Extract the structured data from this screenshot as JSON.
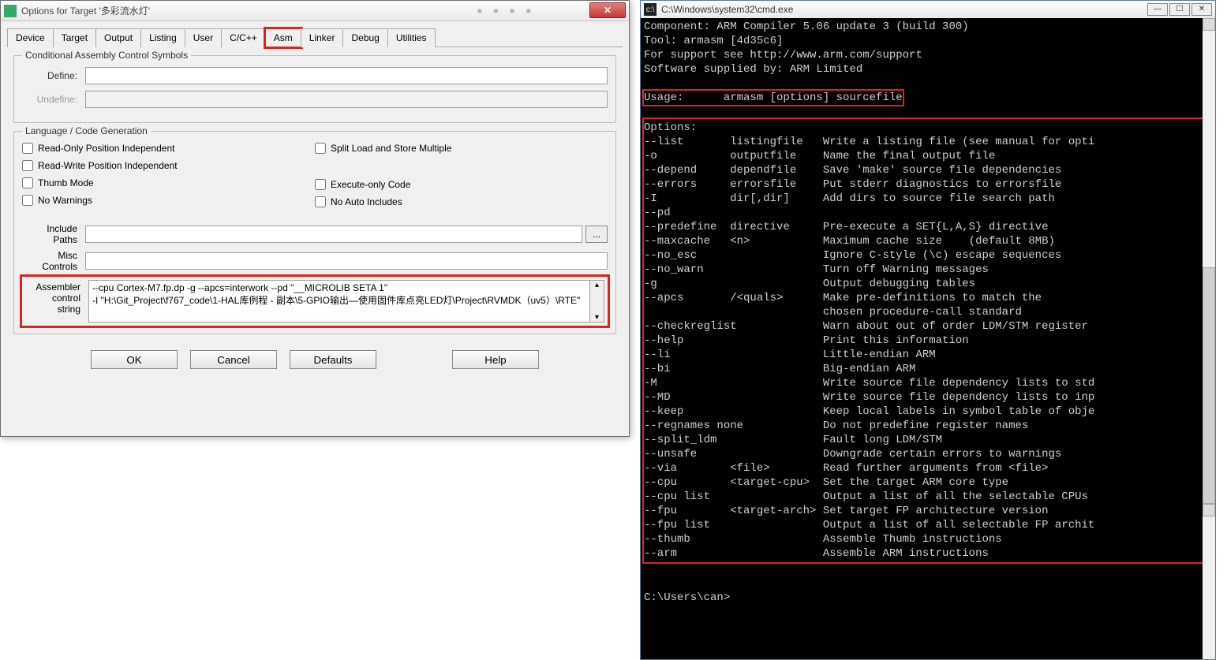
{
  "dialog": {
    "title": "Options for Target '多彩流水灯'",
    "tabs": [
      "Device",
      "Target",
      "Output",
      "Listing",
      "User",
      "C/C++",
      "Asm",
      "Linker",
      "Debug",
      "Utilities"
    ],
    "active_tab": 6,
    "group_conditional": {
      "legend": "Conditional Assembly Control Symbols",
      "define_label": "Define:",
      "undefine_label": "Undefine:",
      "define_value": "",
      "undefine_value": ""
    },
    "group_lang": {
      "legend": "Language / Code Generation",
      "checks_left": [
        "Read-Only Position Independent",
        "Read-Write Position Independent",
        "Thumb Mode",
        "No Warnings"
      ],
      "checks_right": [
        "Split Load and Store Multiple",
        "Execute-only Code",
        "No Auto Includes"
      ]
    },
    "group_paths": {
      "include_label": "Include\nPaths",
      "misc_label": "Misc\nControls",
      "assembler_label": "Assembler\ncontrol\nstring",
      "browse": "...",
      "assembler_value": "--cpu Cortex-M7.fp.dp -g --apcs=interwork --pd \"__MICROLIB SETA 1\"\n-I \"H:\\Git_Project\\f767_code\\1-HAL库例程 - 副本\\5-GPIO输出—使用固件库点亮LED灯\\Project\\RVMDK（uv5）\\RTE\""
    },
    "buttons": {
      "ok": "OK",
      "cancel": "Cancel",
      "defaults": "Defaults",
      "help": "Help"
    }
  },
  "cmd": {
    "title": "C:\\Windows\\system32\\cmd.exe",
    "header": "Component: ARM Compiler 5.06 update 3 (build 300)\nTool: armasm [4d35c6]\nFor support see http://www.arm.com/support\nSoftware supplied by: ARM Limited",
    "usage": "Usage:      armasm [options] sourcefile",
    "options_hdr": "Options:",
    "options_body": "--list       listingfile   Write a listing file (see manual for opti\n-o           outputfile    Name the final output file\n--depend     dependfile    Save 'make' source file dependencies\n--errors     errorsfile    Put stderr diagnostics to errorsfile\n-I           dir[,dir]     Add dirs to source file search path\n--pd\n--predefine  directive     Pre-execute a SET{L,A,S} directive\n--maxcache   <n>           Maximum cache size    (default 8MB)\n--no_esc                   Ignore C-style (\\c) escape sequences\n--no_warn                  Turn off Warning messages\n-g                         Output debugging tables\n--apcs       /<quals>      Make pre-definitions to match the\n                           chosen procedure-call standard\n--checkreglist             Warn about out of order LDM/STM register\n--help                     Print this information\n--li                       Little-endian ARM\n--bi                       Big-endian ARM\n-M                         Write source file dependency lists to std\n--MD                       Write source file dependency lists to inp\n--keep                     Keep local labels in symbol table of obje\n--regnames none            Do not predefine register names\n--split_ldm                Fault long LDM/STM\n--unsafe                   Downgrade certain errors to warnings\n--via        <file>        Read further arguments from <file>\n--cpu        <target-cpu>  Set the target ARM core type\n--cpu list                 Output a list of all the selectable CPUs\n--fpu        <target-arch> Set target FP architecture version\n--fpu list                 Output a list of all selectable FP archit\n--thumb                    Assemble Thumb instructions\n--arm                      Assemble ARM instructions",
    "prompt": "C:\\Users\\can>"
  }
}
